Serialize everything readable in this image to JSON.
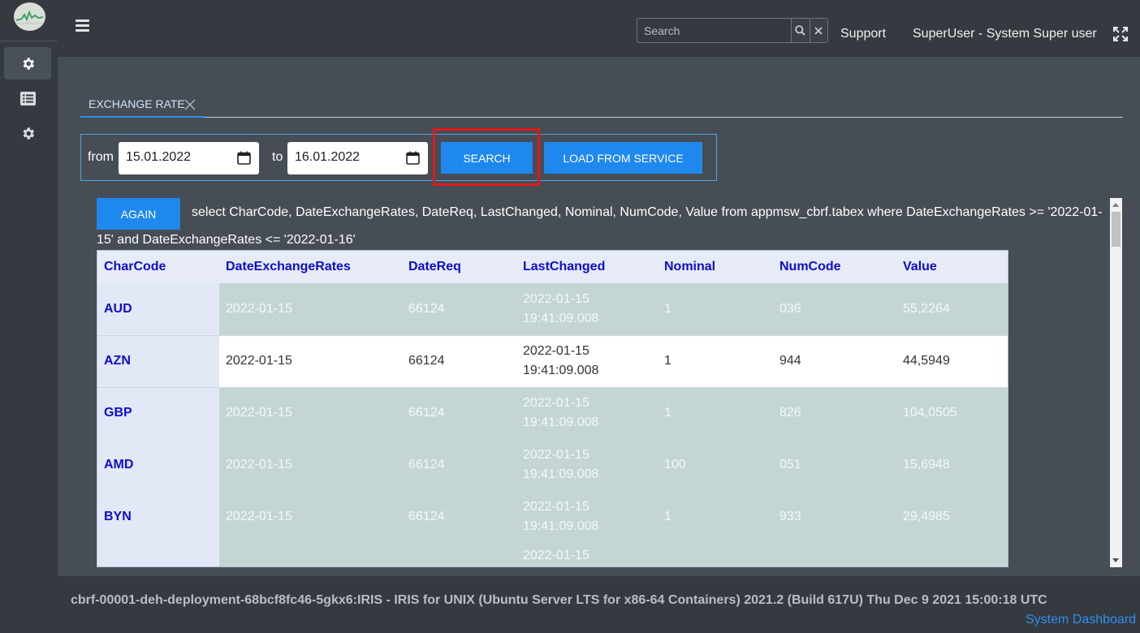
{
  "header": {
    "search_placeholder": "Search",
    "support_label": "Support",
    "user_label": "SuperUser - System Super user"
  },
  "sidebar": {
    "items": [
      {
        "icon": "gear-icon",
        "active": true
      },
      {
        "icon": "list-icon",
        "active": false
      },
      {
        "icon": "gear-icon",
        "active": false
      }
    ]
  },
  "tabs": [
    {
      "label": "EXCHANGE RATE",
      "active": true
    }
  ],
  "filter": {
    "from_label": "from",
    "from_value": "15.01.2022",
    "to_label": "to",
    "to_value": "16.01.2022",
    "search_label": "SEARCH",
    "load_label": "LOAD FROM SERVICE"
  },
  "results": {
    "again_label": "AGAIN",
    "query": "select CharCode, DateExchangeRates, DateReq, LastChanged, Nominal, NumCode, Value from appmsw_cbrf.tabex where DateExchangeRates >= '2022-01-15' and DateExchangeRates <= '2022-01-16'",
    "columns": [
      "CharCode",
      "DateExchangeRates",
      "DateReq",
      "LastChanged",
      "Nominal",
      "NumCode",
      "Value"
    ],
    "rows": [
      {
        "CharCode": "AUD",
        "DateExchangeRates": "2022-01-15",
        "DateReq": "66124",
        "LastChanged": "2022-01-15 19:41:09.008",
        "Nominal": "1",
        "NumCode": "036",
        "Value": "55,2264"
      },
      {
        "CharCode": "AZN",
        "DateExchangeRates": "2022-01-15",
        "DateReq": "66124",
        "LastChanged": "2022-01-15 19:41:09.008",
        "Nominal": "1",
        "NumCode": "944",
        "Value": "44,5949"
      },
      {
        "CharCode": "GBP",
        "DateExchangeRates": "2022-01-15",
        "DateReq": "66124",
        "LastChanged": "2022-01-15 19:41:09.008",
        "Nominal": "1",
        "NumCode": "826",
        "Value": "104,0505"
      },
      {
        "CharCode": "AMD",
        "DateExchangeRates": "2022-01-15",
        "DateReq": "66124",
        "LastChanged": "2022-01-15 19:41:09.008",
        "Nominal": "100",
        "NumCode": "051",
        "Value": "15,6948"
      },
      {
        "CharCode": "BYN",
        "DateExchangeRates": "2022-01-15",
        "DateReq": "66124",
        "LastChanged": "2022-01-15 19:41:09.008",
        "Nominal": "1",
        "NumCode": "933",
        "Value": "29,4985"
      },
      {
        "CharCode": "",
        "DateExchangeRates": "",
        "DateReq": "",
        "LastChanged": "2022-01-15",
        "Nominal": "",
        "NumCode": "",
        "Value": ""
      }
    ]
  },
  "footer": {
    "system_info": "cbrf-00001-deh-deployment-68bcf8fc46-5gkx6:IRIS - IRIS for UNIX (Ubuntu Server LTS for x86-64 Containers) 2021.2 (Build 617U) Thu Dec 9 2021 15:00:18 UTC",
    "dashboard_link": "System Dashboard"
  },
  "colors": {
    "accent": "#1e88ee",
    "highlight": "#e01a1a",
    "header_bg": "#343a40",
    "page_bg": "#464d55"
  }
}
